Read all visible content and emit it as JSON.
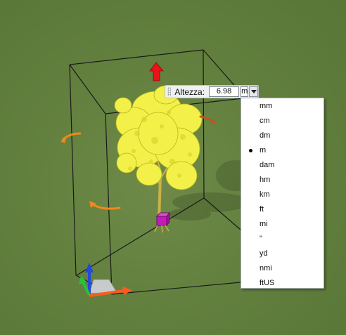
{
  "height_widget": {
    "label": "Altezza:",
    "value": "6.98",
    "unit": "m"
  },
  "unit_menu": {
    "selected": "m",
    "options": [
      "mm",
      "cm",
      "dm",
      "m",
      "dam",
      "hm",
      "km",
      "ft",
      "mi",
      "\"",
      "yd",
      "nmi",
      "ftUS"
    ]
  },
  "colors": {
    "ground": "#63803f",
    "foliage": "#f3f04a",
    "axis_x": "#ff5a1e",
    "axis_y": "#29c23a",
    "axis_z": "#2448d8",
    "height_arrow": "#e8141a",
    "rotate_handle": "#f08a18",
    "pivot": "#c41bb8"
  },
  "icons": {
    "height_arrow": "arrow-up-icon",
    "rotate_handles": "rotate-arrow-icon",
    "pivot": "pivot-cube-icon",
    "axes": "axis-gizmo-icon"
  }
}
